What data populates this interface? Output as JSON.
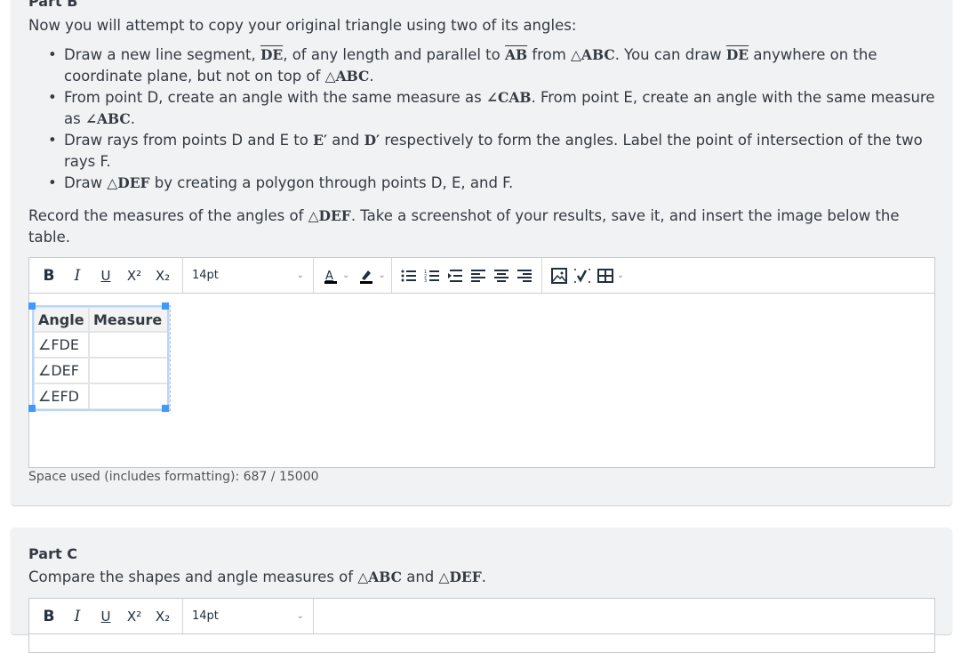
{
  "partB": {
    "title": "Part B",
    "intro": "Now you will attempt to copy your original triangle using two of its angles:",
    "bullets": [
      {
        "t1": "Draw a new line segment, ",
        "m1": "DE",
        "t2": ", of any length and parallel to ",
        "m2": "AB",
        "t3": " from ",
        "m3": "△ABC",
        "t4": ". You can draw ",
        "m4": "DE",
        "t5": " anywhere on the coordinate plane, but not on top of ",
        "m5": "△ABC",
        "t6": "."
      },
      {
        "t1": "From point D, create an angle with the same measure as ",
        "m1": "∠CAB",
        "t2": ". From point E, create an angle with the same measure as ",
        "m2": "∠ABC",
        "t3": "."
      },
      {
        "t1": "Draw rays from points D and E to ",
        "m1": "E′",
        "t2": " and ",
        "m2": "D′",
        "t3": "  respectively to form the angles. Label the point of intersection of the two rays F."
      },
      {
        "t1": "Draw ",
        "m1": "△DEF",
        "t2": "  by creating a polygon through points D, E, and F."
      }
    ],
    "record": {
      "t1": "Record the measures of the angles of ",
      "m1": "△DEF",
      "t2": ". Take a screenshot of your results, save it, and insert the image below the table."
    },
    "editor": {
      "font_size": "14pt",
      "table": {
        "headers": [
          "Angle",
          "Measure"
        ],
        "rows": [
          [
            "∠FDE",
            ""
          ],
          [
            "∠DEF",
            ""
          ],
          [
            "∠EFD",
            ""
          ]
        ]
      }
    },
    "space_used": "Space used (includes formatting): 687 / 15000"
  },
  "toolbar": {
    "bold": "B",
    "italic": "I",
    "underline": "U",
    "superscript": "X²",
    "subscript": "X₂"
  },
  "partC": {
    "title": "Part C",
    "text": {
      "t1": "Compare the shapes and angle measures of ",
      "m1": "△ABC",
      "t2": " and ",
      "m2": "△DEF",
      "t3": "."
    },
    "font_size": "14pt"
  },
  "colors": {
    "accent": "#4099ff",
    "selection": "#b4d7ff",
    "card_bg": "#f1f2f4",
    "text": "#333a41"
  }
}
